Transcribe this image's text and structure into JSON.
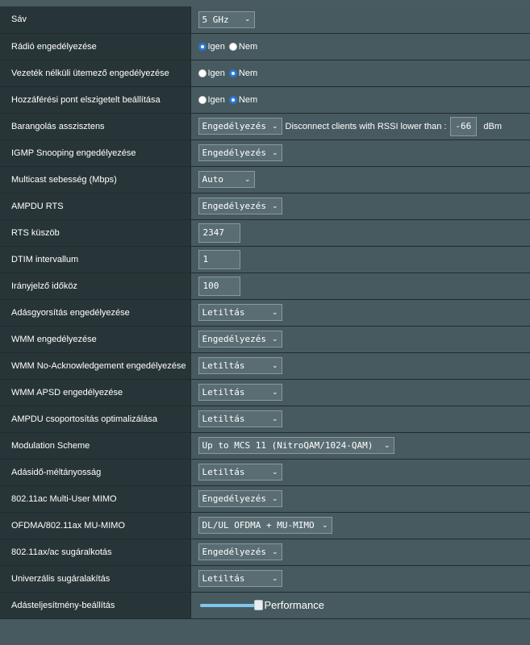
{
  "rows": [
    {
      "label": "Sáv",
      "select": "5 GHz"
    },
    {
      "label": "Rádió engedélyezése",
      "radio": {
        "yes": "Igen",
        "no": "Nem",
        "selected": "Igen"
      }
    },
    {
      "label": "Vezeték nélküli ütemező engedélyezése",
      "radio": {
        "yes": "Igen",
        "no": "Nem",
        "selected": "Nem"
      }
    },
    {
      "label": "Hozzáférési pont elszigetelt beállítása",
      "radio": {
        "yes": "Igen",
        "no": "Nem",
        "selected": "Nem"
      }
    },
    {
      "label": "Barangolás asszisztens",
      "select": "Engedélyezés",
      "extra_text": "Disconnect clients with RSSI lower than :",
      "input": "-66",
      "unit": "dBm"
    },
    {
      "label": "IGMP Snooping engedélyezése",
      "select": "Engedélyezés"
    },
    {
      "label": "Multicast sebesség (Mbps)",
      "select": "Auto"
    },
    {
      "label": "AMPDU RTS",
      "select": "Engedélyezés"
    },
    {
      "label": "RTS küszöb",
      "input": "2347"
    },
    {
      "label": "DTIM intervallum",
      "input": "1"
    },
    {
      "label": "Irányjelző időköz",
      "input": "100"
    },
    {
      "label": "Adásgyorsítás engedélyezése",
      "select": "Letiltás"
    },
    {
      "label": "WMM engedélyezése",
      "select": "Engedélyezés"
    },
    {
      "label": "WMM No-Acknowledgement engedélyezése",
      "select": "Letiltás"
    },
    {
      "label": "WMM APSD engedélyezése",
      "select": "Letiltás"
    },
    {
      "label": "AMPDU csoportosítás optimalizálása",
      "select": "Letiltás"
    },
    {
      "label": "Modulation Scheme",
      "select": "Up to MCS 11 (NitroQAM/1024-QAM)"
    },
    {
      "label": "Adásidő-méltányosság",
      "select": "Letiltás"
    },
    {
      "label": "802.11ac Multi-User MIMO",
      "select": "Engedélyezés"
    },
    {
      "label": "OFDMA/802.11ax MU-MIMO",
      "select": "DL/UL OFDMA + MU-MIMO"
    },
    {
      "label": "802.11ax/ac sugáralkotás",
      "select": "Engedélyezés"
    },
    {
      "label": "Univerzális sugáralakítás",
      "select": "Letiltás"
    },
    {
      "label": "Adásteljesítmény-beállítás",
      "slider": {
        "value": 1.0,
        "text": "Performance"
      }
    }
  ],
  "colors": {
    "label_bg": "#283538",
    "value_bg": "#475a5f",
    "radio_accent": "#2a76d6",
    "slider_fill": "#7fc6ee"
  }
}
